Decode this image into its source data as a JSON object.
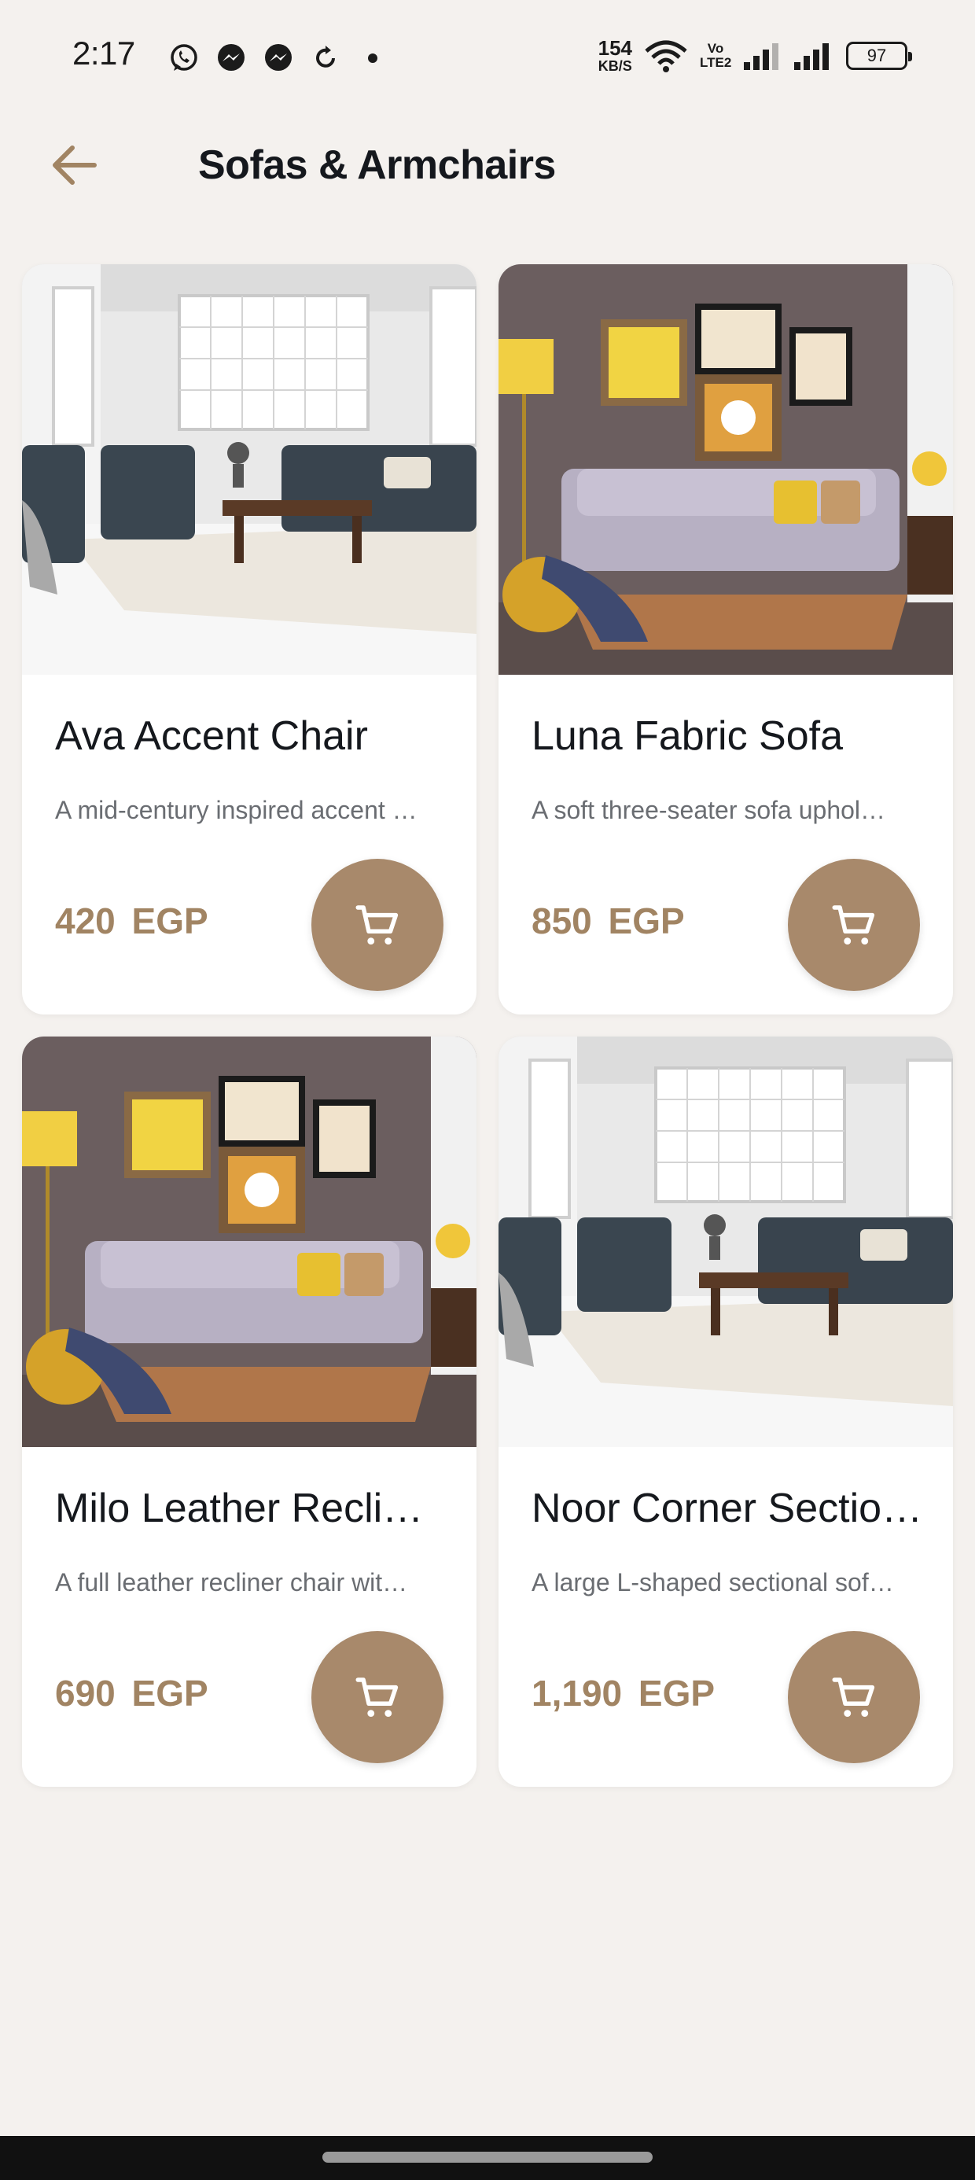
{
  "status_bar": {
    "time": "2:17",
    "app_icons": [
      "whatsapp-icon",
      "messenger-icon",
      "messenger-icon",
      "sync-icon",
      "dot-icon"
    ],
    "net_speed_value": "154",
    "net_speed_unit": "KB/S",
    "battery": "97",
    "volte_label": "Vo LTE2"
  },
  "header": {
    "title": "Sofas & Armchairs",
    "back_icon": "arrow-left-icon"
  },
  "products": [
    {
      "name": "Ava Accent Chair",
      "description": "A mid-century inspired accent …",
      "price": "420  EGP",
      "image": "grey-sofa-set-room"
    },
    {
      "name": "Luna Fabric Sofa",
      "description": "A soft three-seater sofa uphol…",
      "price": "850  EGP",
      "image": "lavender-sofa-room"
    },
    {
      "name": "Milo Leather Recli…",
      "description": "A full leather recliner chair wit…",
      "price": "690  EGP",
      "image": "lavender-sofa-room"
    },
    {
      "name": "Noor Corner Sectio…",
      "description": "A large L-shaped sectional sof…",
      "price": "1,190  EGP",
      "image": "grey-sofa-set-room"
    }
  ],
  "colors": {
    "background": "#f4f1ee",
    "accent": "#a8896b",
    "price": "#a18463",
    "title": "#15181d"
  }
}
